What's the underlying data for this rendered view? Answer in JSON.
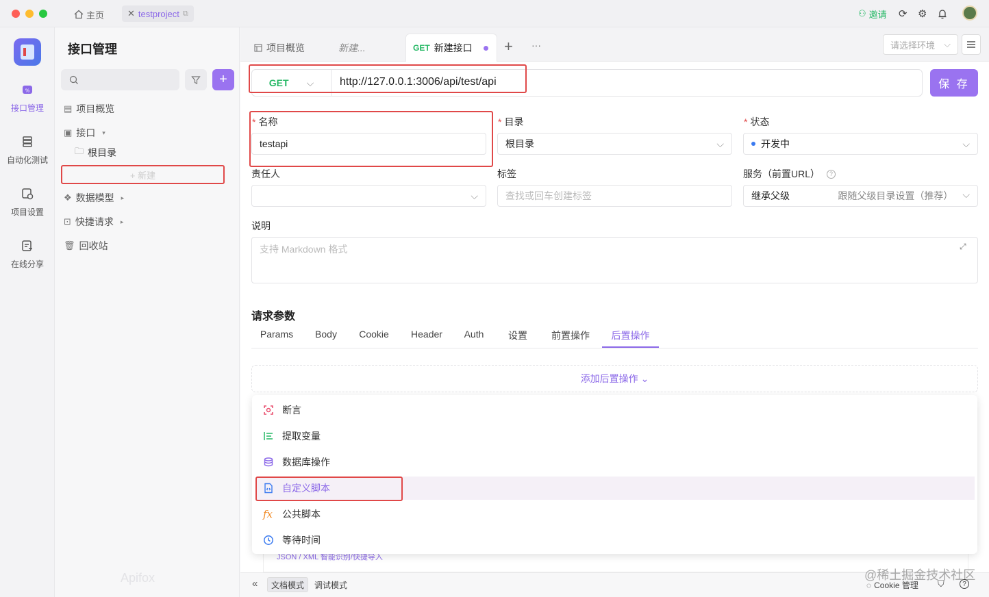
{
  "titlebar": {
    "home_label": "主页",
    "project_tab": "testproject",
    "invite_label": "邀请"
  },
  "rail": [
    {
      "label": "接口管理",
      "icon": "api-icon",
      "active": true
    },
    {
      "label": "自动化测试",
      "icon": "automation-icon",
      "active": false
    },
    {
      "label": "项目设置",
      "icon": "settings-icon",
      "active": false
    },
    {
      "label": "在线分享",
      "icon": "share-icon",
      "active": false
    }
  ],
  "sidebar": {
    "title": "接口管理",
    "items": [
      {
        "label": "项目概览",
        "icon": "overview-icon"
      },
      {
        "label": "接口",
        "icon": "api-icon",
        "caret": "▾"
      },
      {
        "label": "根目录",
        "icon": "folder-icon"
      },
      {
        "label": "数据模型",
        "icon": "model-icon",
        "caret": "▸"
      },
      {
        "label": "快捷请求",
        "icon": "quick-request-icon",
        "caret": "▸"
      },
      {
        "label": "回收站",
        "icon": "trash-icon"
      }
    ],
    "new_label": "+ 新建",
    "watermark": "Apifox"
  },
  "tabs": [
    {
      "label": "项目概览",
      "icon": "overview-icon"
    },
    {
      "label": "新建..."
    },
    {
      "method": "GET",
      "label": "新建接口",
      "active": true
    }
  ],
  "tabs_more": "···",
  "env_placeholder": "请选择环境",
  "request": {
    "method": "GET",
    "url": "http://127.0.0.1:3006/api/test/api",
    "save_label": "保 存"
  },
  "form": {
    "name_label": "名称",
    "name_value": "testapi",
    "dir_label": "目录",
    "dir_value": "根目录",
    "status_label": "状态",
    "status_value": "开发中",
    "owner_label": "责任人",
    "tags_label": "标签",
    "tags_placeholder": "查找或回车创建标签",
    "service_label": "服务（前置URL）",
    "service_value": "继承父级",
    "service_hint": "跟随父级目录设置（推荐）",
    "desc_label": "说明",
    "desc_placeholder": "支持 Markdown 格式"
  },
  "params": {
    "title": "请求参数",
    "tabs": [
      "Params",
      "Body",
      "Cookie",
      "Header",
      "Auth",
      "设置",
      "前置操作",
      "后置操作"
    ],
    "active_tab": "后置操作",
    "add_label": "添加后置操作 ⌄"
  },
  "post_menu": [
    {
      "label": "断言",
      "icon": "assert-icon",
      "color": "#e84a6a"
    },
    {
      "label": "提取变量",
      "icon": "extract-variable-icon",
      "color": "#25b865"
    },
    {
      "label": "数据库操作",
      "icon": "database-icon",
      "color": "#8b68e8"
    },
    {
      "label": "自定义脚本",
      "icon": "script-icon",
      "color": "#3a7af0",
      "highlighted": true
    },
    {
      "label": "公共脚本",
      "icon": "fx-icon",
      "color": "#f08a24"
    },
    {
      "label": "等待时间",
      "icon": "clock-icon",
      "color": "#3a7af0"
    }
  ],
  "hidden_hint": "JSON / XML 智能识别/快捷导入",
  "bottom": {
    "doc_mode": "文档模式",
    "debug_mode": "调试模式",
    "cookie_label": "Cookie 管理",
    "watermark": "@稀土掘金技术社区"
  },
  "colors": {
    "accent": "#9a73f0",
    "get": "#25b865",
    "highlight_box": "#e04848"
  }
}
